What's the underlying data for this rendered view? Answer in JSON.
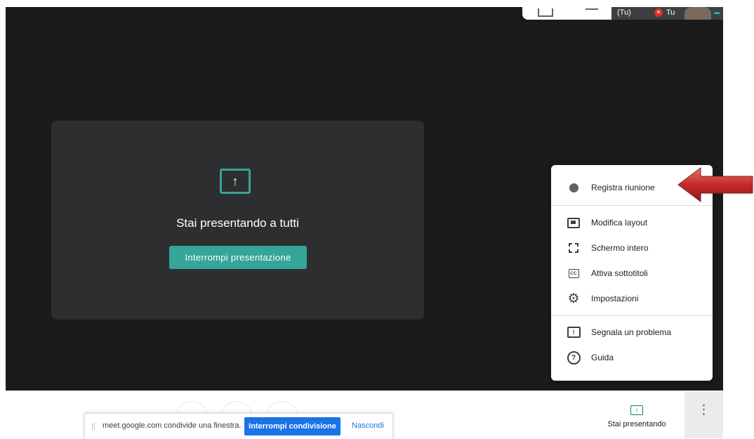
{
  "top_thumbs": {
    "self_label": "(Tu)",
    "self_label2": "Tu",
    "more": "•••"
  },
  "presentation": {
    "icon": "↑",
    "title": "Stai presentando a tutti",
    "stop_label": "Interrompi presentazione"
  },
  "menu": {
    "items": [
      {
        "label": "Registra riunione",
        "icon": "record-icon"
      },
      {
        "label": "Modifica layout",
        "icon": "layout-icon"
      },
      {
        "label": "Schermo intero",
        "icon": "fullscreen-icon"
      },
      {
        "label": "Attiva sottotitoli",
        "icon": "captions-icon",
        "glyph": "CC"
      },
      {
        "label": "Impostazioni",
        "icon": "settings-icon",
        "glyph": "⚙"
      },
      {
        "label": "Segnala un problema",
        "icon": "feedback-icon",
        "glyph": "!"
      },
      {
        "label": "Guida",
        "icon": "help-icon",
        "glyph": "?"
      }
    ]
  },
  "share_bar": {
    "handle": "||",
    "message": "meet.google.com condivide una finestra.",
    "stop_label": "Interrompi condivisione",
    "hide_label": "Nascondi"
  },
  "bottom_right": {
    "presenting_icon": "↑",
    "presenting_label": "Stai presentando",
    "more_glyph": "⋮"
  },
  "colors": {
    "accent_teal": "#34a598",
    "share_blue": "#1a73e8",
    "highlight_arrow": "#c0392b"
  }
}
